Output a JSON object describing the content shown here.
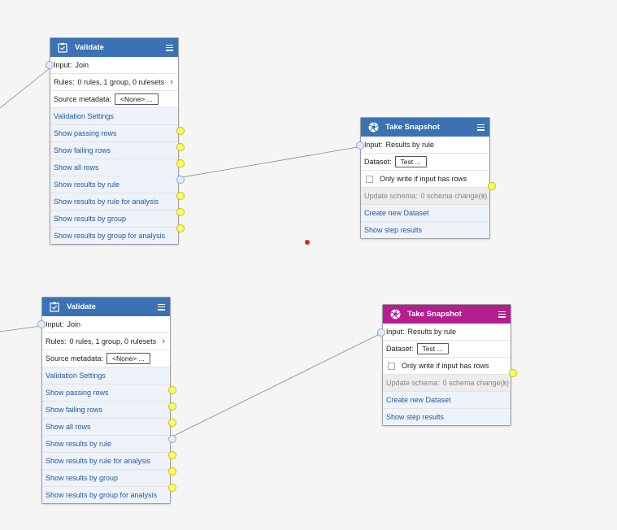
{
  "colors": {
    "validate_header": "#3b72b4",
    "snapshot_header": "#3b72b4",
    "snapshot_header_selected": "#b41e8e",
    "link_text": "#1f5aa6",
    "output_port": "#ffff66"
  },
  "validate_node": {
    "title": "Validate",
    "icon": "clipboard-check-icon",
    "input_label": "Input:",
    "input_value": "Join",
    "rules_label": "Rules:",
    "rules_value": "0 rules, 1 group, 0 rulesets",
    "source_metadata_label": "Source metadata:",
    "source_metadata_value": "<None> ...",
    "settings_link": "Validation Settings",
    "outputs": [
      "Show passing rows",
      "Show failing rows",
      "Show all rows",
      "Show results by rule",
      "Show results by rule for analysis",
      "Show results by group",
      "Show results by group for analysis"
    ]
  },
  "snapshot_node": {
    "title": "Take Snapshot",
    "icon": "camera-shutter-icon",
    "input_label": "Input:",
    "input_value": "Results by rule",
    "dataset_label": "Dataset:",
    "dataset_value": "Test ...",
    "checkbox_label": "Only write if input has rows",
    "schema_label": "Update schema:",
    "schema_value": "0 schema change(s)",
    "create_link": "Create new Dataset",
    "results_link": "Show step results"
  }
}
